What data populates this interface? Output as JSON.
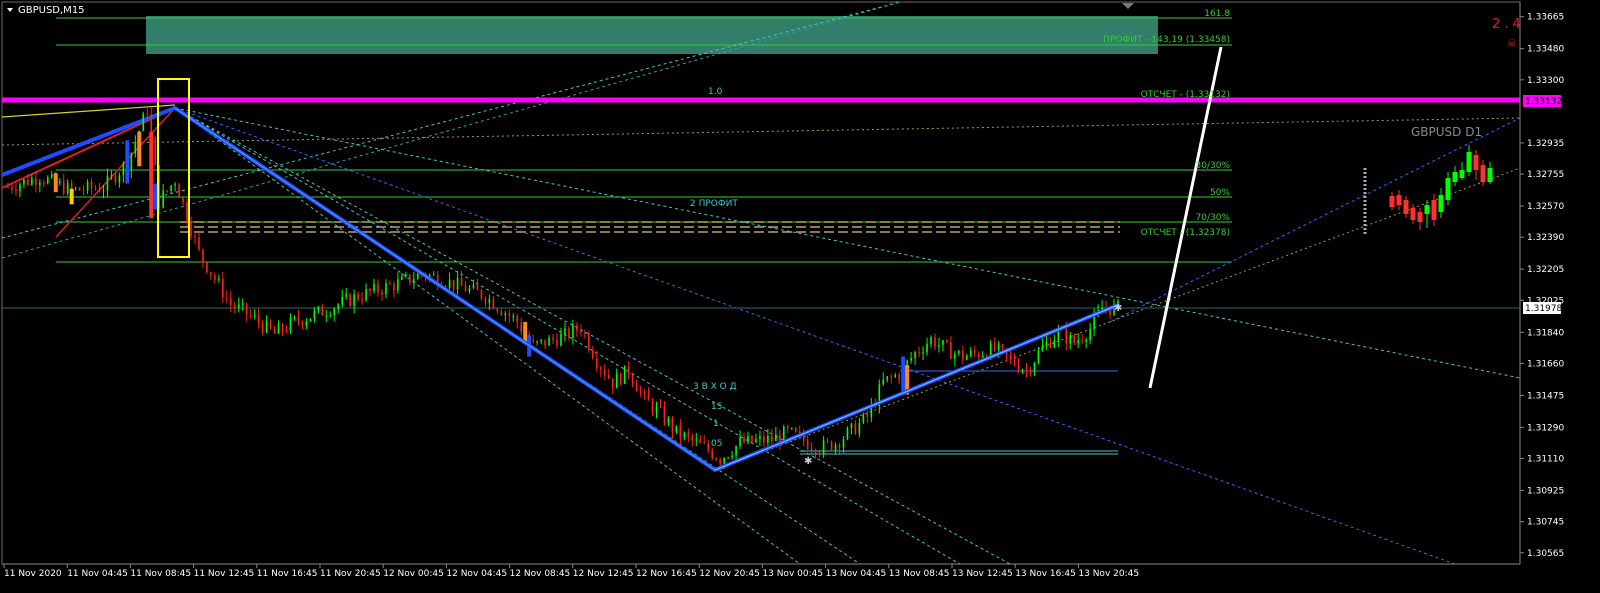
{
  "header": {
    "symbol_timeframe": "GBPUSD,M15",
    "inset_label": "GBPUSD D1",
    "corner_value": "2.4"
  },
  "colors": {
    "background": "#000000",
    "bull_candle": "#00ff00",
    "bear_candle": "#ff2020",
    "fib_line": "#33cc33",
    "magenta_level": "#ff00ff",
    "blue_channel": "#1e4cff",
    "cyan_trend": "#40c8c8",
    "yellow_box": "#ffff00",
    "profit_zone": "#3a8f7a",
    "white_arrow": "#ffffff",
    "current_price_line": "#2a6a6a"
  },
  "chart_data": {
    "type": "candlestick",
    "symbol": "GBPUSD",
    "timeframe": "M15",
    "y_range": [
      1.305,
      1.3375
    ],
    "current_price": 1.31978,
    "price_ticks": [
      "1.33665",
      "1.33480",
      "1.33300",
      "1.33132",
      "1.32935",
      "1.32755",
      "1.32570",
      "1.32390",
      "1.32205",
      "1.32025",
      "1.31978",
      "1.31840",
      "1.31660",
      "1.31475",
      "1.31290",
      "1.31110",
      "1.30925",
      "1.30745",
      "1.30565"
    ],
    "time_ticks": [
      "11 Nov 2020",
      "11 Nov 04:45",
      "11 Nov 08:45",
      "11 Nov 12:45",
      "11 Nov 16:45",
      "11 Nov 20:45",
      "12 Nov 00:45",
      "12 Nov 04:45",
      "12 Nov 08:45",
      "12 Nov 12:45",
      "12 Nov 16:45",
      "12 Nov 20:45",
      "13 Nov 00:45",
      "13 Nov 04:45",
      "13 Nov 08:45",
      "13 Nov 12:45",
      "13 Nov 16:45",
      "13 Nov 20:45"
    ],
    "key_points": [
      {
        "label": "swing-high",
        "time": "11 Nov 08:45",
        "price": 1.33132
      },
      {
        "label": "swing-low",
        "time": "12 Nov 20:45",
        "price": 1.3111
      },
      {
        "label": "last",
        "time": "13 Nov 20:45",
        "price": 1.31978
      }
    ],
    "levels": [
      {
        "label": "161.8",
        "price": 1.3362
      },
      {
        "label": "ПРОФИТ - 143,19 (1.33458)",
        "price": 1.33458
      },
      {
        "label": "ОТСЧЕТ - (1.33132)",
        "price": 1.33132
      },
      {
        "label": "30/30%",
        "price": 1.3285
      },
      {
        "label": "50%",
        "price": 1.3273
      },
      {
        "label": "70/30%",
        "price": 1.3261
      },
      {
        "label": "ОТСЧЕТ - (1.32378)",
        "price": 1.32378
      }
    ],
    "annotations": [
      "1.0",
      "2 ПРОФИТ",
      "3 В Х О Д",
      "15",
      "1",
      "05"
    ],
    "close_path": [
      [
        "11 Nov 00:00",
        1.3268
      ],
      [
        "11 Nov 02:00",
        1.3274
      ],
      [
        "11 Nov 04:00",
        1.3266
      ],
      [
        "11 Nov 06:00",
        1.3268
      ],
      [
        "11 Nov 07:30",
        1.3282
      ],
      [
        "11 Nov 08:45",
        1.3313
      ],
      [
        "11 Nov 09:30",
        1.326
      ],
      [
        "11 Nov 10:30",
        1.3272
      ],
      [
        "11 Nov 12:00",
        1.323
      ],
      [
        "11 Nov 13:00",
        1.3215
      ],
      [
        "11 Nov 14:00",
        1.32
      ],
      [
        "11 Nov 15:00",
        1.3195
      ],
      [
        "11 Nov 16:45",
        1.3183
      ],
      [
        "11 Nov 18:00",
        1.319
      ],
      [
        "11 Nov 20:00",
        1.3197
      ],
      [
        "11 Nov 22:00",
        1.3205
      ],
      [
        "12 Nov 00:45",
        1.3213
      ],
      [
        "12 Nov 02:00",
        1.3218
      ],
      [
        "12 Nov 04:00",
        1.3212
      ],
      [
        "12 Nov 06:00",
        1.3205
      ],
      [
        "12 Nov 08:00",
        1.319
      ],
      [
        "12 Nov 09:00",
        1.3176
      ],
      [
        "12 Nov 11:00",
        1.3182
      ],
      [
        "12 Nov 12:00",
        1.3187
      ],
      [
        "12 Nov 13:00",
        1.3168
      ],
      [
        "12 Nov 14:00",
        1.3155
      ],
      [
        "12 Nov 15:00",
        1.3162
      ],
      [
        "12 Nov 16:00",
        1.3145
      ],
      [
        "12 Nov 17:00",
        1.3137
      ],
      [
        "12 Nov 18:00",
        1.3126
      ],
      [
        "12 Nov 20:00",
        1.3116
      ],
      [
        "12 Nov 20:45",
        1.3111
      ],
      [
        "12 Nov 22:00",
        1.312
      ],
      [
        "13 Nov 00:00",
        1.3122
      ],
      [
        "13 Nov 01:00",
        1.3126
      ],
      [
        "13 Nov 03:00",
        1.3117
      ],
      [
        "13 Nov 04:00",
        1.312
      ],
      [
        "13 Nov 05:00",
        1.3127
      ],
      [
        "13 Nov 06:00",
        1.3135
      ],
      [
        "13 Nov 07:00",
        1.3155
      ],
      [
        "13 Nov 08:00",
        1.316
      ],
      [
        "13 Nov 09:00",
        1.3172
      ],
      [
        "13 Nov 10:00",
        1.318
      ],
      [
        "13 Nov 11:00",
        1.3174
      ],
      [
        "13 Nov 12:00",
        1.317
      ],
      [
        "13 Nov 14:00",
        1.3174
      ],
      [
        "13 Nov 16:00",
        1.3162
      ],
      [
        "13 Nov 17:00",
        1.3175
      ],
      [
        "13 Nov 18:00",
        1.3184
      ],
      [
        "13 Nov 19:00",
        1.3178
      ],
      [
        "13 Nov 20:00",
        1.3186
      ],
      [
        "13 Nov 20:45",
        1.3198
      ]
    ]
  }
}
